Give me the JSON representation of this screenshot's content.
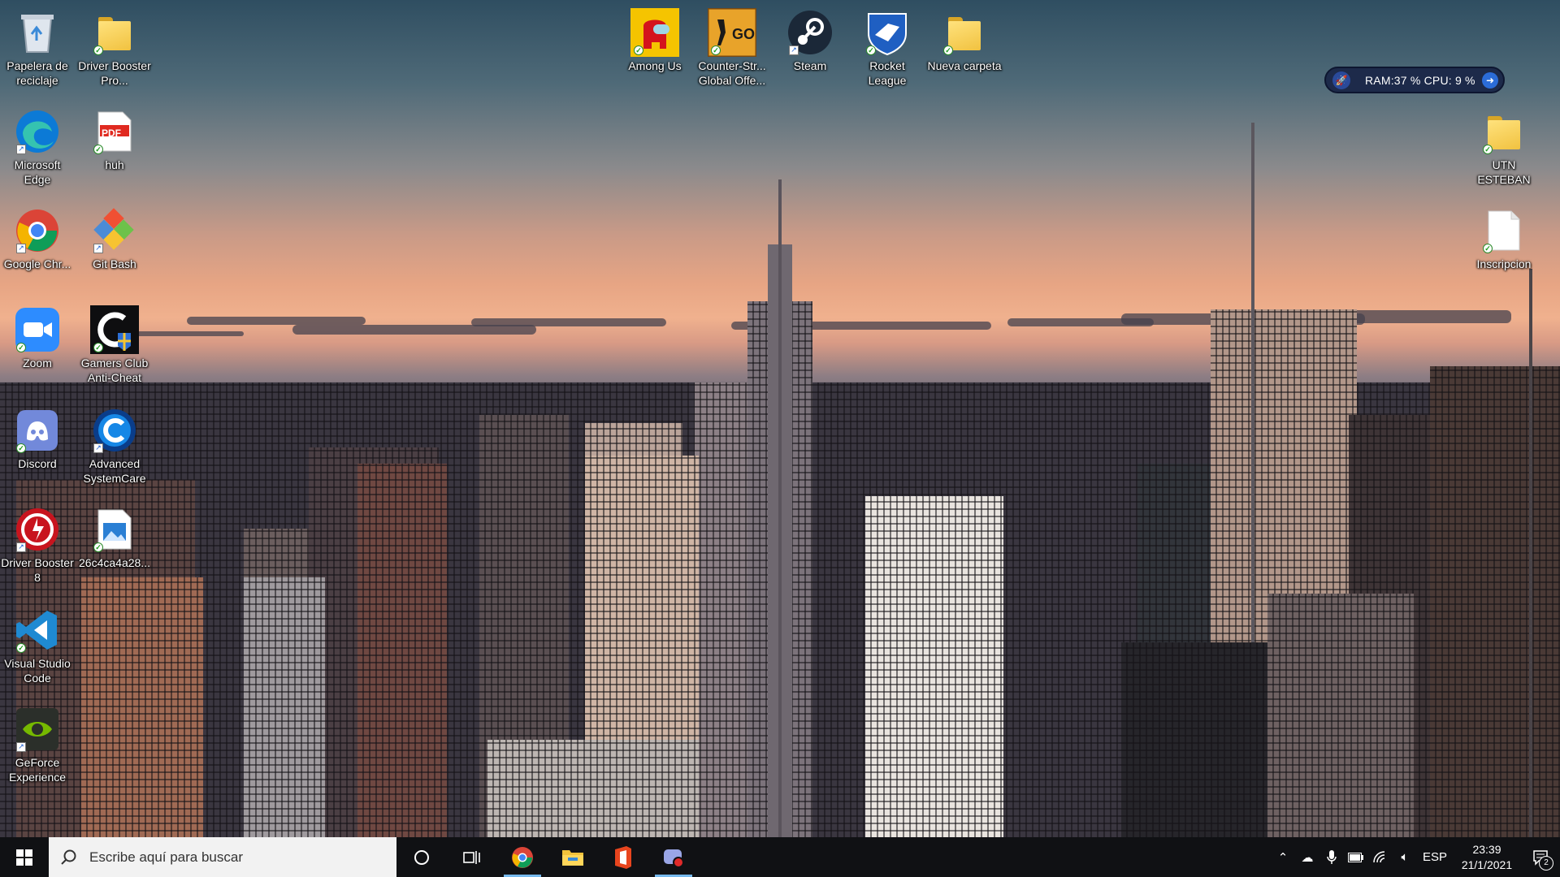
{
  "desktop": {
    "icons_left": [
      {
        "label": "Papelera de reciclaje",
        "icon": "recycle-bin-icon"
      },
      {
        "label": "Driver Booster Pro...",
        "icon": "folder-icon"
      },
      {
        "label": "Microsoft Edge",
        "icon": "edge-icon"
      },
      {
        "label": "huh",
        "icon": "pdf-icon",
        "badge": "PDF"
      },
      {
        "label": "Google Chr...",
        "icon": "chrome-icon"
      },
      {
        "label": "Git Bash",
        "icon": "git-bash-icon"
      },
      {
        "label": "Zoom",
        "icon": "zoom-icon"
      },
      {
        "label": "Gamers Club Anti-Cheat",
        "icon": "gamers-club-icon"
      },
      {
        "label": "Discord",
        "icon": "discord-icon"
      },
      {
        "label": "Advanced SystemCare",
        "icon": "advanced-systemcare-icon"
      },
      {
        "label": "Driver Booster 8",
        "icon": "driver-booster-icon"
      },
      {
        "label": "26c4ca4a28...",
        "icon": "image-file-icon"
      },
      {
        "label": "Visual Studio Code",
        "icon": "vscode-icon"
      },
      {
        "label": "GeForce Experience",
        "icon": "geforce-icon"
      }
    ],
    "icons_top": [
      {
        "label": "Among Us",
        "icon": "among-us-icon"
      },
      {
        "label": "Counter-Str... Global Offe...",
        "icon": "csgo-icon",
        "badge": "GO"
      },
      {
        "label": "Steam",
        "icon": "steam-icon"
      },
      {
        "label": "Rocket League",
        "icon": "rocket-league-icon"
      },
      {
        "label": "Nueva carpeta",
        "icon": "folder-icon"
      }
    ],
    "icons_right": [
      {
        "label": "UTN ESTEBAN",
        "icon": "folder-icon"
      },
      {
        "label": "Inscripcion",
        "icon": "document-icon"
      }
    ]
  },
  "widget": {
    "text": "RAM:37 %   CPU: 9 %"
  },
  "taskbar": {
    "search_placeholder": "Escribe aquí para buscar",
    "apps": [
      "cortana-icon",
      "task-view-icon",
      "chrome-icon",
      "file-explorer-icon",
      "office-icon",
      "discord-record-icon"
    ],
    "language": "ESP",
    "time": "23:39",
    "date": "21/1/2021",
    "notification_count": "2"
  },
  "colors": {
    "taskbar": "#101114",
    "search_bg": "#f2f2f2",
    "active_indicator": "#76b9ed"
  }
}
